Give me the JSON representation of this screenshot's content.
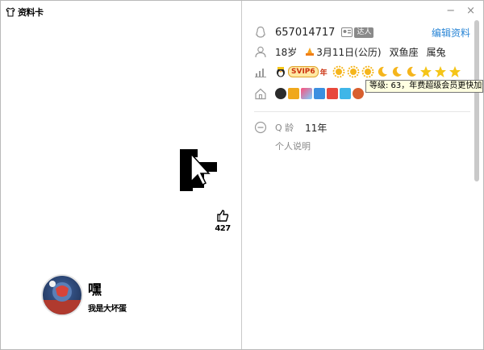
{
  "window": {
    "title": "资料卡"
  },
  "controls": {
    "minimize": "−",
    "close": "×"
  },
  "left": {
    "like_count": "427",
    "nickname": "嘿",
    "subtitle": "我是大坏蛋"
  },
  "profile": {
    "qq_number": "657014717",
    "qq_tag": "达人",
    "edit_label": "编辑资料",
    "age": "18岁",
    "birthday": "3月11日(公历)",
    "zodiac": "双鱼座",
    "chinese_zodiac": "属兔",
    "svip_label": "SVIP6",
    "svip_year": "年",
    "tooltip": "等级: 63，年费超级会员更快加速",
    "q_age_label": "Q 龄",
    "q_age_value": "11年",
    "bio_label": "个人说明"
  },
  "colors": {
    "accent": "#2a86d6",
    "sun": "#f5b51c",
    "moon": "#f5b51c",
    "star": "#f5c518",
    "desktop_red": "#c94a3c"
  },
  "icons": [
    "qq-icon",
    "person-icon",
    "level-chart-icon",
    "house-icon",
    "age-minus-icon",
    "thumb-up-icon",
    "cursor-icon",
    "shirt-icon"
  ]
}
